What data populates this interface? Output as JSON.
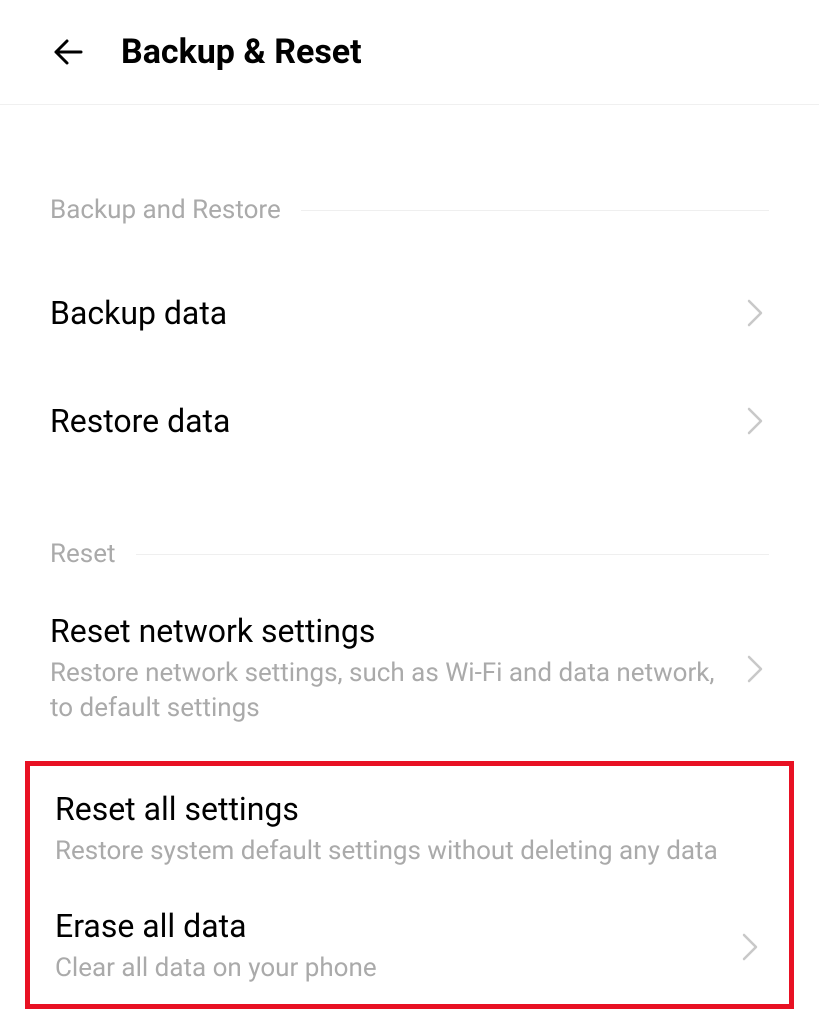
{
  "header": {
    "title": "Backup & Reset"
  },
  "sections": {
    "backup": {
      "header": "Backup and Restore",
      "items": {
        "backup_data": {
          "title": "Backup data"
        },
        "restore_data": {
          "title": "Restore data"
        }
      }
    },
    "reset": {
      "header": "Reset",
      "items": {
        "reset_network": {
          "title": "Reset network settings",
          "subtitle": "Restore network settings, such as Wi-Fi and data network, to default settings"
        },
        "reset_all": {
          "title": "Reset all settings",
          "subtitle": "Restore system default settings without deleting any data"
        },
        "erase_all": {
          "title": "Erase all data",
          "subtitle": "Clear all data on your phone"
        }
      }
    }
  }
}
